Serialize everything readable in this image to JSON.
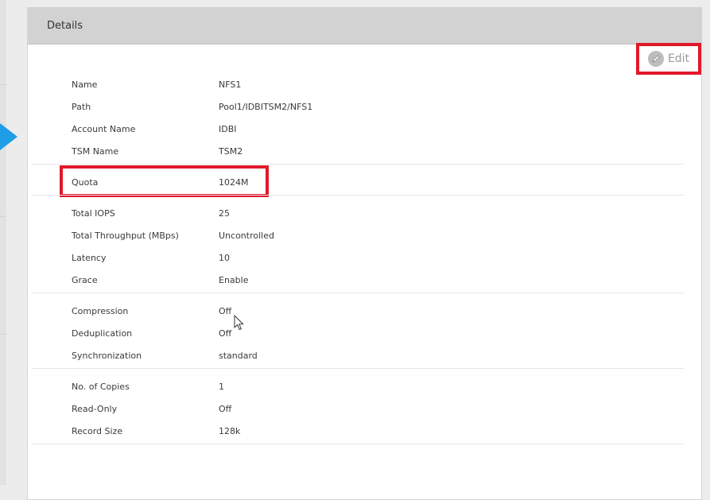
{
  "panel": {
    "title": "Details",
    "edit_label": "Edit"
  },
  "details": {
    "name": {
      "label": "Name",
      "value": "NFS1"
    },
    "path": {
      "label": "Path",
      "value": "Pool1/IDBITSM2/NFS1"
    },
    "account_name": {
      "label": "Account Name",
      "value": "IDBI"
    },
    "tsm_name": {
      "label": "TSM Name",
      "value": "TSM2"
    },
    "quota": {
      "label": "Quota",
      "value": "1024M"
    },
    "total_iops": {
      "label": "Total IOPS",
      "value": "25"
    },
    "total_throughput": {
      "label": "Total Throughput (MBps)",
      "value": "Uncontrolled"
    },
    "latency": {
      "label": "Latency",
      "value": "10"
    },
    "grace": {
      "label": "Grace",
      "value": "Enable"
    },
    "compression": {
      "label": "Compression",
      "value": "Off"
    },
    "deduplication": {
      "label": "Deduplication",
      "value": "Off"
    },
    "synchronization": {
      "label": "Synchronization",
      "value": "standard"
    },
    "copies": {
      "label": "No. of Copies",
      "value": "1"
    },
    "read_only": {
      "label": "Read-Only",
      "value": "Off"
    },
    "record_size": {
      "label": "Record Size",
      "value": "128k"
    }
  },
  "colors": {
    "highlight": "#e0192a",
    "nav_arrow": "#1e9ee6",
    "header_bg": "#d2d2d2"
  },
  "icons": [
    "pencil-icon",
    "nav-arrow-icon",
    "mouse-cursor-icon"
  ]
}
